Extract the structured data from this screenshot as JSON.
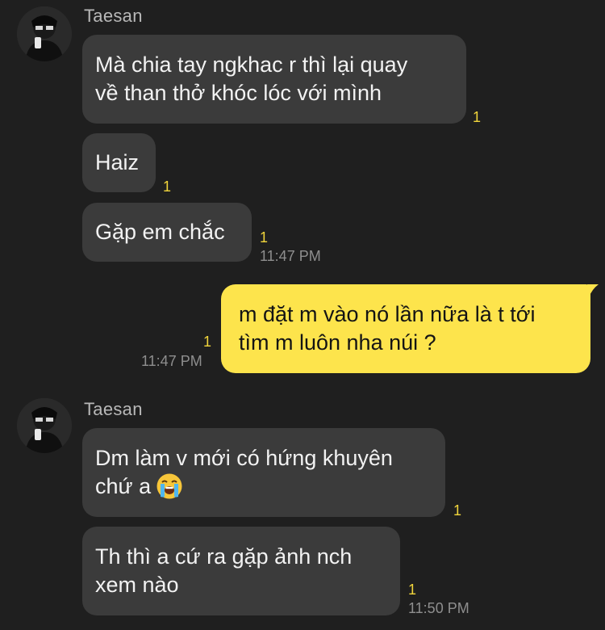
{
  "groups": [
    {
      "sender": "Taesan",
      "messages": [
        {
          "text": "Mà chia tay ngkhac r thì lại quay\nvề than thở khóc lóc với mình",
          "unread": "1"
        },
        {
          "text": "Haiz",
          "unread": "1"
        },
        {
          "text": "Gặp em chắc",
          "unread": "1",
          "time": "11:47 PM"
        }
      ]
    },
    {
      "sender": "me",
      "messages": [
        {
          "text": "m đặt m vào nó lần nữa là t tới\ntìm m luôn nha núi ?",
          "unread": "1",
          "time": "11:47 PM"
        }
      ]
    },
    {
      "sender": "Taesan",
      "messages": [
        {
          "text": "Dm làm v mới có hứng khuyên\nchứ a",
          "emoji": "loudly-crying-face",
          "unread": "1"
        },
        {
          "text": "Th thì a cứ ra gặp ảnh nch\nxem nào",
          "unread": "1",
          "time": "11:50 PM"
        }
      ]
    }
  ],
  "colors": {
    "background": "#1f1f1f",
    "incoming_bubble": "#3b3b3b",
    "outgoing_bubble": "#fde44c",
    "unread_count": "#f1d53c",
    "timestamp": "#8e8e8e"
  }
}
